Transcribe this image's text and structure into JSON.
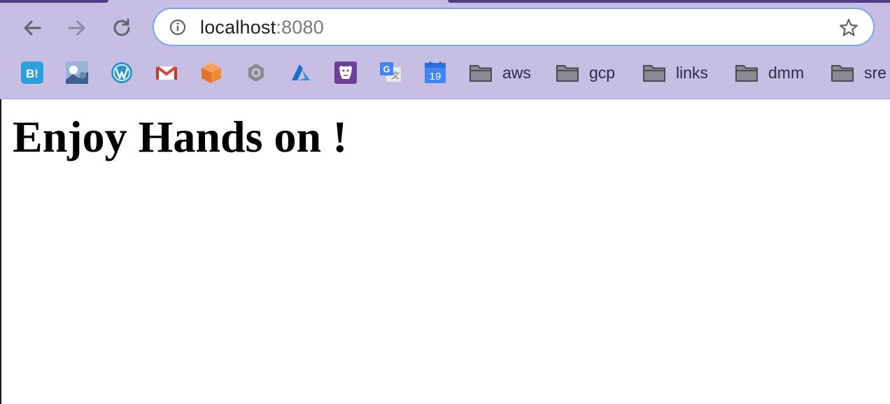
{
  "toolbar": {
    "url_host": "localhost",
    "url_port": ":8080"
  },
  "bookmarks": {
    "icons": [
      {
        "name": "hatena-bookmark-icon",
        "label": "B!"
      },
      {
        "name": "bookmark-2-icon"
      },
      {
        "name": "wordpress-icon"
      },
      {
        "name": "gmail-icon"
      },
      {
        "name": "box-icon"
      },
      {
        "name": "gcp-icon"
      },
      {
        "name": "azure-icon"
      },
      {
        "name": "datadog-icon"
      },
      {
        "name": "google-translate-icon",
        "label": "G"
      },
      {
        "name": "google-calendar-icon",
        "label": "19"
      }
    ],
    "folders": [
      {
        "label": "aws"
      },
      {
        "label": "gcp"
      },
      {
        "label": "links"
      },
      {
        "label": "dmm"
      },
      {
        "label": "sre"
      }
    ]
  },
  "page": {
    "heading": "Enjoy Hands on !"
  },
  "colors": {
    "chrome_bg": "#c6bfe3",
    "omnibox_border": "#7aa5ef",
    "tab_dark": "#4f3f86"
  }
}
